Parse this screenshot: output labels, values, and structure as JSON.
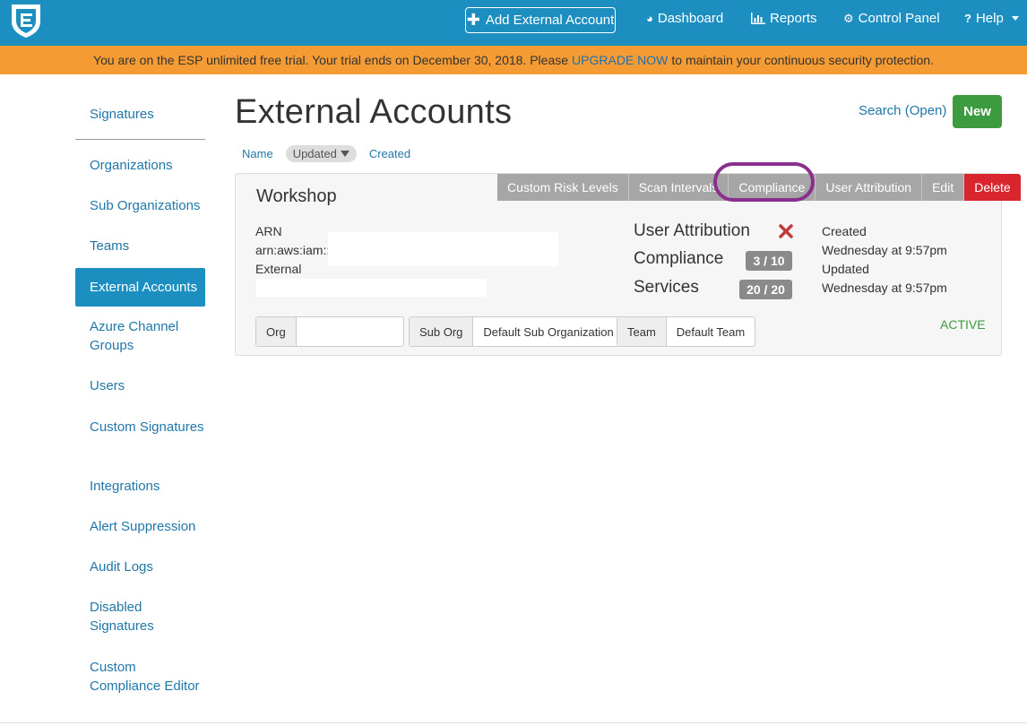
{
  "topbar": {
    "add_account": "Add External Account",
    "nav": [
      {
        "label": "Dashboard",
        "icon": "dashboard-icon"
      },
      {
        "label": "Reports",
        "icon": "bar-chart-icon"
      },
      {
        "label": "Control Panel",
        "icon": "gears-icon"
      },
      {
        "label": "Help",
        "icon": "question-icon"
      }
    ]
  },
  "banner": {
    "before": "You are on the ESP unlimited free trial. Your trial ends on December 30, 2018. Please",
    "link": "UPGRADE NOW",
    "after": "to maintain your continuous security protection."
  },
  "sidebar": {
    "items": [
      {
        "label": "Signatures"
      },
      {
        "label": "Organizations"
      },
      {
        "label": "Sub Organizations"
      },
      {
        "label": "Teams"
      },
      {
        "label": "External Accounts",
        "active": true
      },
      {
        "label": "Azure Channel Groups"
      },
      {
        "label": "Users"
      },
      {
        "label": "Custom Signatures"
      },
      {
        "label": "Integrations"
      },
      {
        "label": "Alert Suppression"
      },
      {
        "label": "Audit Logs"
      },
      {
        "label": "Disabled Signatures"
      },
      {
        "label": "Custom Compliance Editor"
      }
    ]
  },
  "main": {
    "title": "External Accounts",
    "search": "Search (Open)",
    "new": "New",
    "sort": {
      "name": "Name",
      "updated": "Updated",
      "created": "Created"
    }
  },
  "card": {
    "name": "Workshop",
    "tabs": [
      "Custom Risk Levels",
      "Scan Intervals",
      "Compliance",
      "User Attribution",
      "Edit",
      "Delete"
    ],
    "arn_label": "ARN",
    "arn_value": "arn:aws:iam::",
    "external_label": "External",
    "metrics": {
      "user_attribution": "User Attribution",
      "compliance": "Compliance",
      "compliance_value": "3 / 10",
      "services": "Services",
      "services_value": "20 / 20"
    },
    "created_label": "Created",
    "created_value": "Wednesday at 9:57pm",
    "updated_label": "Updated",
    "updated_value": "Wednesday at 9:57pm",
    "org_label": "Org",
    "sub_org_label": "Sub Org",
    "sub_org_value": "Default Sub Organization",
    "team_label": "Team",
    "team_value": "Default Team",
    "status": "ACTIVE"
  },
  "colors": {
    "topbar": "#1c8fc0",
    "banner": "#f49b33",
    "new_button": "#3c9a3f",
    "delete_tab": "#d9262e",
    "highlight": "#8b2f8e"
  }
}
